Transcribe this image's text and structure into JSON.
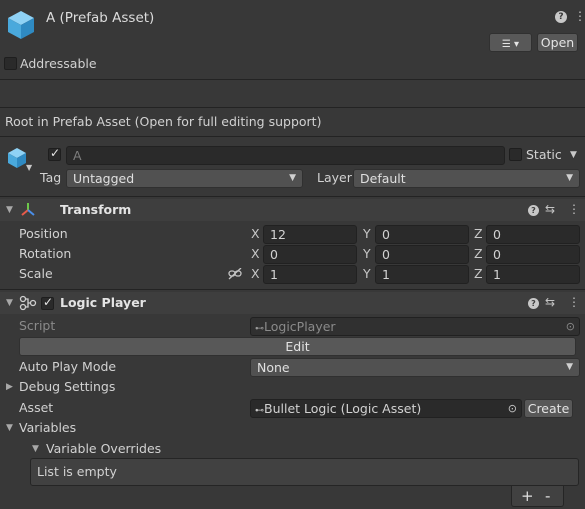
{
  "header": {
    "title": "A (Prefab Asset)",
    "open_label": "Open",
    "addressable_label": "Addressable",
    "info_text": "Root in Prefab Asset (Open for full editing support)"
  },
  "gameobject": {
    "name": "A",
    "static_label": "Static",
    "tag_label": "Tag",
    "tag_value": "Untagged",
    "layer_label": "Layer",
    "layer_value": "Default"
  },
  "transform": {
    "title": "Transform",
    "rows": [
      {
        "label": "Position",
        "x": "12",
        "y": "0",
        "z": "0"
      },
      {
        "label": "Rotation",
        "x": "0",
        "y": "0",
        "z": "0"
      },
      {
        "label": "Scale",
        "x": "1",
        "y": "1",
        "z": "1"
      }
    ],
    "axes": {
      "x": "X",
      "y": "Y",
      "z": "Z"
    }
  },
  "logic_player": {
    "title": "Logic Player",
    "script_label": "Script",
    "script_value": "LogicPlayer",
    "edit_label": "Edit",
    "auto_play_label": "Auto Play Mode",
    "auto_play_value": "None",
    "debug_label": "Debug Settings",
    "asset_label": "Asset",
    "asset_value": "Bullet Logic (Logic Asset)",
    "create_label": "Create",
    "variables_label": "Variables",
    "overrides_label": "Variable Overrides",
    "list_empty": "List is empty",
    "add_label": "+",
    "remove_label": "-"
  },
  "icons": [
    "prefab-cube-icon",
    "help-icon",
    "menu-icon",
    "presets-icon",
    "transform-axes-icon",
    "logic-player-icon",
    "script-icon",
    "target-icon",
    "link-icon"
  ]
}
